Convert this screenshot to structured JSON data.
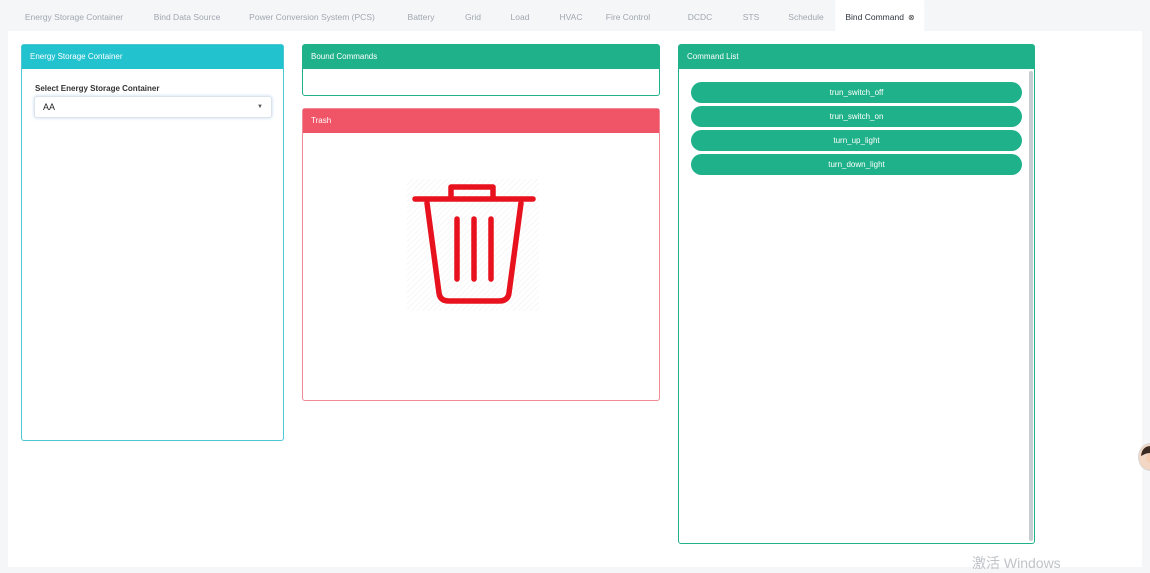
{
  "tabs": [
    {
      "label": "Energy Storage Container"
    },
    {
      "label": "Bind Data Source"
    },
    {
      "label": "Power Conversion System (PCS)"
    },
    {
      "label": "Battery"
    },
    {
      "label": "Grid"
    },
    {
      "label": "Load"
    },
    {
      "label": "HVAC"
    },
    {
      "label": "Fire Control"
    },
    {
      "label": "DCDC"
    },
    {
      "label": "STS"
    },
    {
      "label": "Schedule"
    },
    {
      "label": "Bind Command",
      "active": true
    }
  ],
  "active_tab_close": "⊗",
  "container_panel": {
    "title": "Energy Storage Container",
    "field_label": "Select Energy Storage Container",
    "selected_value": "AA"
  },
  "bound_panel": {
    "title": "Bound Commands"
  },
  "trash_panel": {
    "title": "Trash",
    "icon": "trash-icon"
  },
  "command_panel": {
    "title": "Command List",
    "commands": [
      "trun_switch_off",
      "trun_switch_on",
      "turn_up_light",
      "turn_down_light"
    ]
  },
  "watermark": "激活 Windows",
  "colors": {
    "teal": "#1fb18a",
    "cyan": "#23c2cf",
    "trash_header": "#ef5566",
    "trash_icon": "#e8121f"
  }
}
